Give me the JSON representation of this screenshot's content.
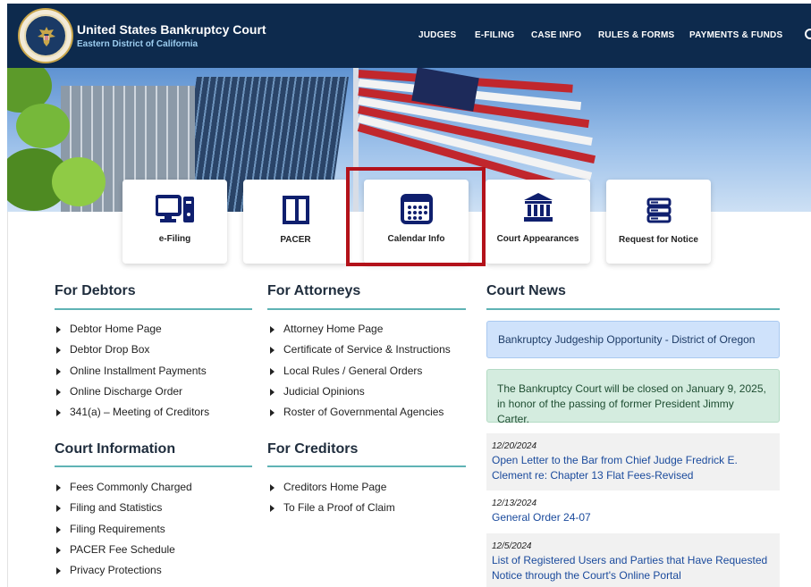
{
  "header": {
    "court_name": "United States Bankruptcy Court",
    "district": "Eastern District of California",
    "nav": [
      "JUDGES",
      "E-FILING",
      "CASE INFO",
      "RULES & FORMS",
      "PAYMENTS & FUNDS"
    ]
  },
  "quick_links": [
    {
      "label": "e-Filing",
      "icon": "computer-icon"
    },
    {
      "label": "PACER",
      "icon": "book-icon"
    },
    {
      "label": "Calendar Info",
      "icon": "calendar-icon",
      "highlighted": true
    },
    {
      "label": "Court Appearances",
      "icon": "courthouse-icon"
    },
    {
      "label": "Request for Notice",
      "icon": "stacked-database-icon"
    }
  ],
  "for_debtors": {
    "title": "For Debtors",
    "links": [
      "Debtor Home Page",
      "Debtor Drop Box",
      "Online Installment Payments",
      "Online Discharge Order",
      "341(a) – Meeting of Creditors"
    ]
  },
  "for_attorneys": {
    "title": "For Attorneys",
    "links": [
      "Attorney Home Page",
      "Certificate of Service & Instructions",
      "Local Rules / General Orders",
      "Judicial Opinions",
      "Roster of Governmental Agencies"
    ]
  },
  "court_information": {
    "title": "Court Information",
    "links": [
      "Fees Commonly Charged",
      "Filing and Statistics",
      "Filing Requirements",
      "PACER Fee Schedule",
      "Privacy Protections"
    ]
  },
  "for_creditors": {
    "title": "For Creditors",
    "links": [
      "Creditors Home Page",
      "To File a Proof of Claim"
    ]
  },
  "court_news": {
    "title": "Court News",
    "alert_blue": "Bankruptcy Judgeship Opportunity - District of Oregon",
    "alert_green": "The Bankruptcy Court will be closed on January 9, 2025, in honor of the passing of former President Jimmy Carter.",
    "items": [
      {
        "date": "12/20/2024",
        "title": "Open Letter to the Bar from Chief Judge Fredrick E. Clement re: Chapter 13 Flat Fees-Revised"
      },
      {
        "date": "12/13/2024",
        "title": "General Order 24-07"
      },
      {
        "date": "12/5/2024",
        "title": "List of Registered Users and Parties that Have Requested Notice through the Court's Online Portal"
      }
    ]
  },
  "colors": {
    "header_bg": "#0d2a4d",
    "accent_rule": "#5fb3b5",
    "highlight_box": "#b3121a",
    "icon_navy": "#0f1f6e",
    "link_blue": "#1a4a9c"
  }
}
